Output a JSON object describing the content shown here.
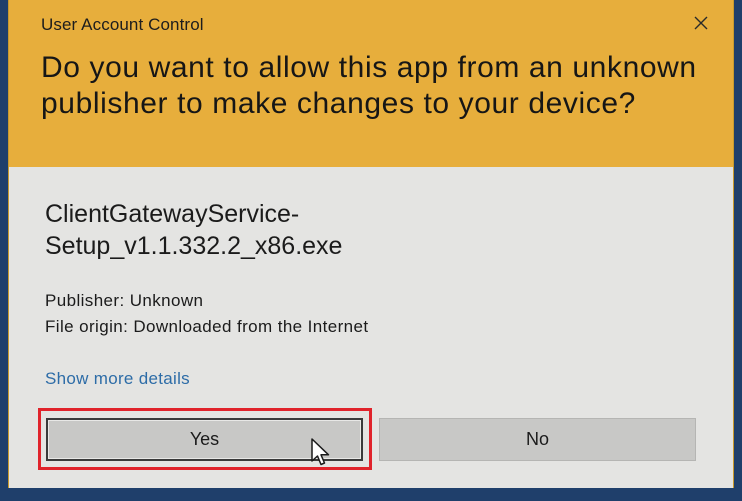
{
  "dialog": {
    "title": "User Account Control",
    "question": "Do you want to allow this app from an unknown publisher to make changes to your device?",
    "filename": "ClientGatewayService-\nSetup_v1.1.332.2_x86.exe",
    "publisher": "Publisher: Unknown",
    "file_origin": "File origin: Downloaded from the Internet",
    "show_more_link": "Show more details",
    "yes_label": "Yes",
    "no_label": "No"
  },
  "icons": {
    "close": "close-icon",
    "cursor": "mouse-pointer-icon"
  },
  "colors": {
    "header_bg": "#e7ae3c",
    "body_bg": "#e4e4e2",
    "link": "#2d6ca7",
    "highlight": "#e0232b"
  }
}
